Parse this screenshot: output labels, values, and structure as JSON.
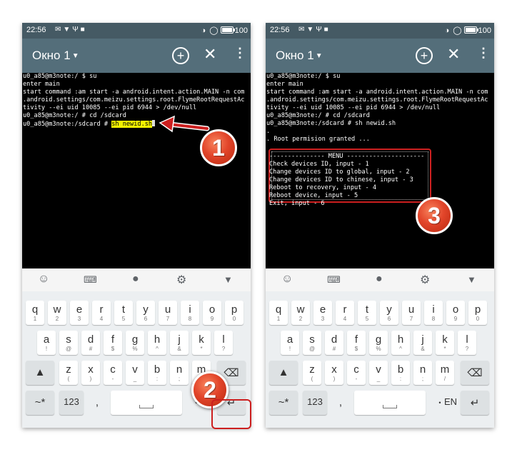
{
  "status_bar": {
    "time": "22:56",
    "battery": "100"
  },
  "app_bar": {
    "title": "Окно 1"
  },
  "terminal_left": [
    "u0_a85@m3note:/ $ su",
    "enter main",
    "start command :am start -a android.intent.action.MAIN -n com",
    ".android.settings/com.meizu.settings.root.FlymeRootRequestAc",
    "tivity --ei uid 10085 --ei pid 6944 > /dev/null",
    "u0_a85@m3note:/ # cd /sdcard"
  ],
  "terminal_left_prompt": "u0_a85@m3note:/sdcard # ",
  "terminal_left_command": "sh newid.sh",
  "terminal_right": [
    "u0_a85@m3note:/ $ su",
    "enter main",
    "start command :am start -a android.intent.action.MAIN -n com",
    ".android.settings/com.meizu.settings.root.FlymeRootRequestAc",
    "tivity --ei uid 10085 --ei pid 6944 > /dev/null",
    "u0_a85@m3note:/ # cd /sdcard",
    "u0_a85@m3note:/sdcard # sh newid.sh",
    ".",
    ". Root permision granted ...",
    ""
  ],
  "menu_lines": [
    "--------------- MENU ---------------------",
    "Check devices ID, input - 1",
    "Change devices ID to global, input - 2",
    "Change devices ID to chinese, input - 3",
    "Reboot to recovery, input - 4",
    "Reboot device, input - 5",
    "Exit, input - 6"
  ],
  "keyboard": {
    "row1": [
      [
        "q",
        "1"
      ],
      [
        "w",
        "2"
      ],
      [
        "e",
        "3"
      ],
      [
        "r",
        "4"
      ],
      [
        "t",
        "5"
      ],
      [
        "y",
        "6"
      ],
      [
        "u",
        "7"
      ],
      [
        "i",
        "8"
      ],
      [
        "o",
        "9"
      ],
      [
        "p",
        "0"
      ]
    ],
    "row2": [
      [
        "a",
        "!"
      ],
      [
        "s",
        "@"
      ],
      [
        "d",
        "#"
      ],
      [
        "f",
        "$"
      ],
      [
        "g",
        "%"
      ],
      [
        "h",
        "^"
      ],
      [
        "j",
        "&"
      ],
      [
        "k",
        "*"
      ],
      [
        "l",
        "?"
      ]
    ],
    "row3": [
      [
        "z",
        "("
      ],
      [
        "x",
        ")"
      ],
      [
        "c",
        "-"
      ],
      [
        "v",
        "_"
      ],
      [
        "b",
        ":"
      ],
      [
        "n",
        ";"
      ],
      [
        "m",
        "/"
      ]
    ],
    "symbols_label": "~*",
    "numbers_label": "123",
    "comma_label": ",",
    "period_label": "•",
    "lang_label": "EN"
  },
  "badges": {
    "one": "1",
    "two": "2",
    "three": "3"
  },
  "accent": "#cc1f1f",
  "highlight": "#f2f200"
}
